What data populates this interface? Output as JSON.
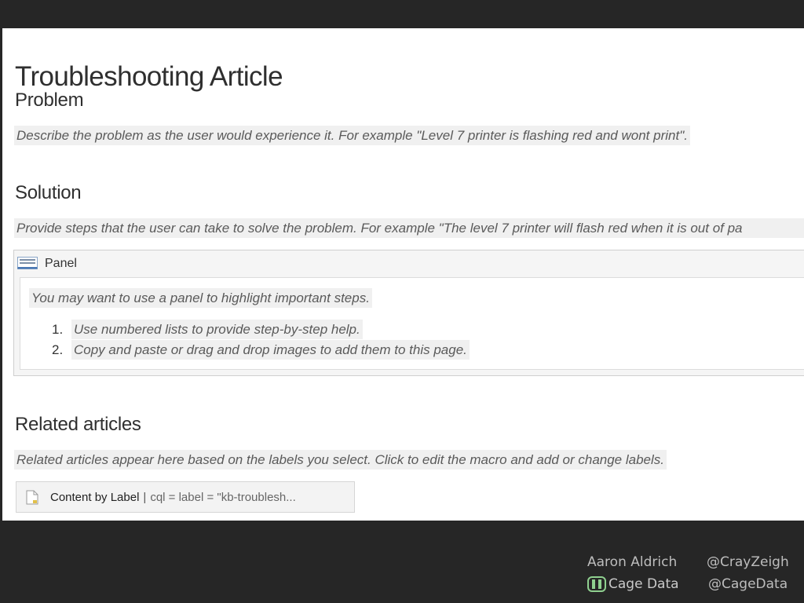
{
  "article": {
    "title": "Troubleshooting Article",
    "problem": {
      "heading": "Problem",
      "placeholder": "Describe the problem as the user would experience it. For example \"Level 7 printer is flashing red and wont print\"."
    },
    "solution": {
      "heading": "Solution",
      "placeholder": "Provide steps that the user can take to solve the problem. For example \"The level 7 printer will flash red when it is out of pa"
    },
    "panel": {
      "label": "Panel",
      "intro": "You may want to use a panel to highlight important steps.",
      "steps": [
        {
          "number": "1.",
          "text": "Use numbered lists to provide step-by-step help."
        },
        {
          "number": "2.",
          "text": "Copy and paste or drag and drop images to add them to this page."
        }
      ]
    },
    "related": {
      "heading": "Related articles",
      "placeholder": "Related articles appear here based on the labels you select. Click to edit the macro and add or change labels.",
      "macro": {
        "name": "Content by Label",
        "separator": "|",
        "params": "cql = label = \"kb-troublesh..."
      }
    }
  },
  "footer": {
    "author": "Aaron Aldrich",
    "author_handle": "@CrayZeigh",
    "company": "Cage Data",
    "company_handle": "@CageData",
    "logo_icon": "cage-data-logo-icon"
  },
  "colors": {
    "background": "#262626",
    "placeholder_bg": "#f0f0f0",
    "panel_bg": "#f5f5f5",
    "logo_green": "#8fd08f"
  }
}
